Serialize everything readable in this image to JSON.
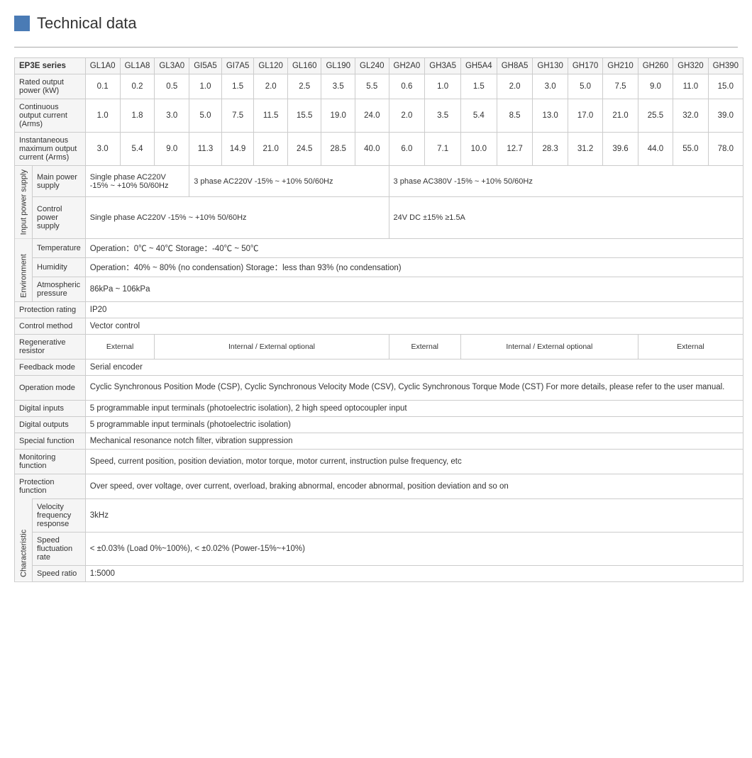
{
  "title": "Technical data",
  "header": {
    "series_label": "EP3E series",
    "models": [
      "GL1A0",
      "GL1A8",
      "GL3A0",
      "GI5A5",
      "GI7A5",
      "GL120",
      "GL160",
      "GL190",
      "GL240",
      "GH2A0",
      "GH3A5",
      "GH5A4",
      "GH8A5",
      "GH130",
      "GH170",
      "GH210",
      "GH260",
      "GH320",
      "GH390"
    ]
  },
  "rows": {
    "rated_output_label": "Rated output power (kW)",
    "rated_output": [
      "0.1",
      "0.2",
      "0.5",
      "1.0",
      "1.5",
      "2.0",
      "2.5",
      "3.5",
      "5.5",
      "0.6",
      "1.0",
      "1.5",
      "2.0",
      "3.0",
      "5.0",
      "7.5",
      "9.0",
      "11.0",
      "15.0"
    ],
    "continuous_output_label": "Continuous output current (Arms)",
    "continuous_output": [
      "1.0",
      "1.8",
      "3.0",
      "5.0",
      "7.5",
      "11.5",
      "15.5",
      "19.0",
      "24.0",
      "2.0",
      "3.5",
      "5.4",
      "8.5",
      "13.0",
      "17.0",
      "21.0",
      "25.5",
      "32.0",
      "39.0"
    ],
    "instantaneous_label": "Instantaneous maximum output current (Arms)",
    "instantaneous": [
      "3.0",
      "5.4",
      "9.0",
      "11.3",
      "14.9",
      "21.0",
      "24.5",
      "28.5",
      "40.0",
      "6.0",
      "7.1",
      "10.0",
      "12.7",
      "28.3",
      "31.2",
      "39.6",
      "44.0",
      "55.0",
      "78.0"
    ]
  },
  "input_power_supply": {
    "section_label": "Input power supply",
    "main_power": {
      "label": "Main power supply",
      "col1": "Single phase AC220V -15% ~ +10% 50/60Hz",
      "col2": "3 phase AC220V -15% ~ +10%  50/60Hz",
      "col3": "3 phase AC380V -15% ~ +10%  50/60Hz"
    },
    "control_power": {
      "label": "Control power supply",
      "col1": "Single phase    AC220V   -15%  ~ +10%   50/60Hz",
      "col2": "24V DC    ±15%   ≥1.5A"
    }
  },
  "environment": {
    "section_label": "Environment",
    "temperature": {
      "label": "Temperature",
      "value": "Operation：0℃ ~ 40℃              Storage：-40℃ ~ 50℃"
    },
    "humidity": {
      "label": "Humidity",
      "value": "Operation：40%  ~ 80%  (no condensation)              Storage：less than 93% (no condensation)"
    },
    "atmospheric": {
      "label": "Atmospheric pressure",
      "value": "86kPa  ~ 106kPa"
    }
  },
  "protection_rating": {
    "label": "Protection rating",
    "value": "IP20"
  },
  "control_method": {
    "label": "Control method",
    "value": "Vector control"
  },
  "regenerative_resistor": {
    "label": "Regenerative resistor",
    "col1": "External",
    "col2": "Internal / External optional",
    "col3": "External",
    "col4": "Internal / External optional",
    "col5": "External"
  },
  "feedback_mode": {
    "label": "Feedback mode",
    "value": "Serial encoder"
  },
  "operation_mode": {
    "label": "Operation mode",
    "value": "Cyclic Synchronous Position Mode (CSP), Cyclic Synchronous Velocity Mode (CSV), Cyclic Synchronous Torque Mode (CST) For more details, please refer to  the user manual."
  },
  "digital_inputs": {
    "label": "Digital inputs",
    "value": "5 programmable input terminals (photoelectric isolation), 2 high speed optocoupler input"
  },
  "digital_outputs": {
    "label": "Digital outputs",
    "value": "5 programmable input terminals (photoelectric isolation)"
  },
  "special_function": {
    "label": "Special function",
    "value": "Mechanical resonance notch filter, vibration suppression"
  },
  "monitoring_function": {
    "label": "Monitoring function",
    "value": "Speed, current position, position deviation, motor torque, motor current, instruction pulse frequency, etc"
  },
  "protection_function": {
    "label": "Protection function",
    "value": "Over speed, over voltage, over current, overload, braking abnormal, encoder abnormal, position deviation and so on"
  },
  "characteristic": {
    "section_label": "Characteristic",
    "velocity_freq": {
      "label": "Velocity frequency response",
      "value": "3kHz"
    },
    "speed_fluctuation": {
      "label": "Speed fluctuation rate",
      "value": "< ±0.03% (Load 0%~100%),   < ±0.02% (Power-15%~+10%)"
    },
    "speed_ratio": {
      "label": "Speed ratio",
      "value": "1:5000"
    }
  }
}
